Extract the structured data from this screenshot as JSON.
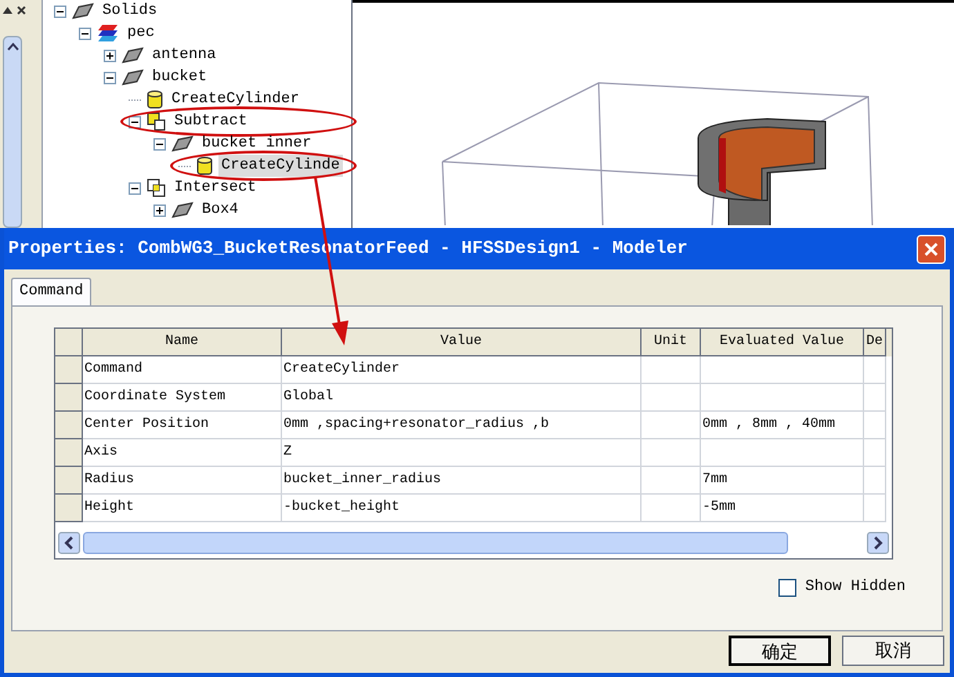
{
  "tree": [
    {
      "label": "Solids",
      "kind": "solid",
      "expanded": true,
      "selected": false,
      "circled": false,
      "children": [
        {
          "label": "pec",
          "kind": "material",
          "expanded": true,
          "selected": false,
          "circled": false,
          "children": [
            {
              "label": "antenna",
              "kind": "solid",
              "expanded": false,
              "selected": false,
              "circled": false
            },
            {
              "label": "bucket",
              "kind": "solid",
              "expanded": true,
              "selected": false,
              "circled": false,
              "children": [
                {
                  "label": "CreateCylinder",
                  "kind": "cylinder",
                  "selected": false,
                  "circled": false
                },
                {
                  "label": "Subtract",
                  "kind": "subtract",
                  "expanded": true,
                  "selected": false,
                  "circled": true,
                  "children": [
                    {
                      "label": "bucket inner",
                      "kind": "solid",
                      "expanded": true,
                      "selected": false,
                      "circled": false,
                      "children": [
                        {
                          "label": "CreateCylinde",
                          "kind": "cylinder",
                          "selected": true,
                          "circled": true
                        }
                      ]
                    }
                  ]
                },
                {
                  "label": "Intersect",
                  "kind": "intersect",
                  "expanded": true,
                  "selected": false,
                  "circled": false,
                  "children": [
                    {
                      "label": "Box4",
                      "kind": "solid",
                      "expanded": false,
                      "selected": false,
                      "circled": false
                    }
                  ]
                }
              ]
            }
          ]
        }
      ]
    }
  ],
  "dialog": {
    "title": "Properties: CombWG3_BucketResonatorFeed - HFSSDesign1 - Modeler",
    "tabs": [
      {
        "label": "Command",
        "selected": true
      }
    ],
    "table": {
      "columns": [
        "Name",
        "Value",
        "Unit",
        "Evaluated Value",
        "De"
      ],
      "rows": [
        {
          "name": "Command",
          "value": "CreateCylinder"
        },
        {
          "name": "Coordinate System",
          "value": "Global"
        },
        {
          "name": "Center Position",
          "value": "0mm ,spacing+resonator_radius ,b",
          "evaluated": "0mm , 8mm , 40mm"
        },
        {
          "name": "Axis",
          "value": "Z"
        },
        {
          "name": "Radius",
          "value": "bucket_inner_radius",
          "evaluated": "7mm"
        },
        {
          "name": "Height",
          "value": "-bucket_height",
          "evaluated": "-5mm"
        }
      ]
    },
    "show_hidden": {
      "label": "Show Hidden",
      "checked": false
    },
    "buttons": [
      "确定",
      "取消"
    ]
  }
}
